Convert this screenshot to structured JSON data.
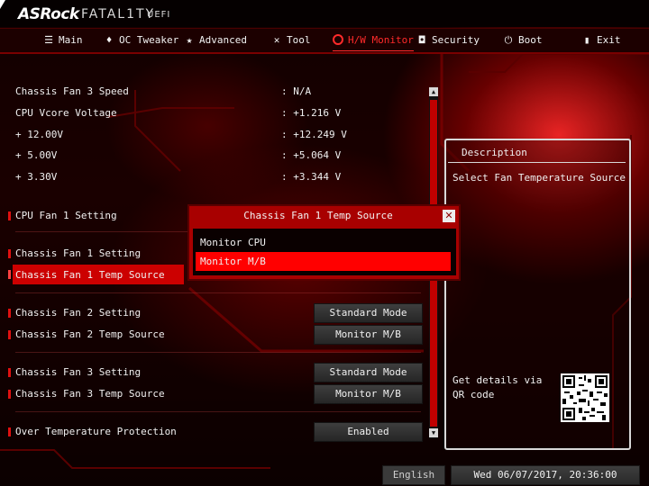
{
  "brand": {
    "asrock": "ASRock",
    "fatality": "FATAL1TY",
    "uefi": "UEFI"
  },
  "nav": {
    "tabs": [
      {
        "label": "Main",
        "icon": "menu-lines-icon",
        "active": false
      },
      {
        "label": "OC Tweaker",
        "icon": "flame-icon",
        "active": false
      },
      {
        "label": "Advanced",
        "icon": "star-icon",
        "active": false
      },
      {
        "label": "Tool",
        "icon": "tools-icon",
        "active": false
      },
      {
        "label": "H/W Monitor",
        "icon": "power-ring-icon",
        "active": true
      },
      {
        "label": "Security",
        "icon": "shield-icon",
        "active": false
      },
      {
        "label": "Boot",
        "icon": "power-icon",
        "active": false
      },
      {
        "label": "Exit",
        "icon": "exit-door-icon",
        "active": false
      }
    ]
  },
  "monitor": [
    {
      "label": "Chassis Fan 3 Speed",
      "value": ": N/A"
    },
    {
      "label": "CPU Vcore Voltage",
      "value": ": +1.216 V"
    },
    {
      "label": "+ 12.00V",
      "value": ": +12.249 V"
    },
    {
      "label": "+ 5.00V",
      "value": ": +5.064 V"
    },
    {
      "label": "+ 3.30V",
      "value": ": +3.344 V"
    }
  ],
  "settings": [
    {
      "label": "CPU Fan 1 Setting",
      "value": ""
    },
    {
      "label": "Chassis Fan 1 Setting",
      "value": ""
    },
    {
      "label": "Chassis Fan 1 Temp Source",
      "value": "",
      "selected": true
    },
    {
      "label": "Chassis Fan 2 Setting",
      "value": "Standard Mode"
    },
    {
      "label": "Chassis Fan 2 Temp Source",
      "value": "Monitor M/B"
    },
    {
      "label": "Chassis Fan 3 Setting",
      "value": "Standard Mode"
    },
    {
      "label": "Chassis Fan 3 Temp Source",
      "value": "Monitor M/B"
    },
    {
      "label": "Over Temperature Protection",
      "value": "Enabled"
    }
  ],
  "popup": {
    "title": "Chassis Fan 1 Temp Source",
    "close": "✕",
    "options": [
      "Monitor CPU",
      "Monitor M/B"
    ],
    "selected_index": 1
  },
  "description": {
    "title": "Description",
    "text": "Select Fan Temperature Source",
    "qr_text": "Get details via QR code"
  },
  "footer": {
    "language": "English",
    "datetime": "Wed 06/07/2017, 20:36:00"
  },
  "colors": {
    "accent": "#ff2a2a",
    "selection": "#cc0000",
    "popup": "#a80000"
  }
}
